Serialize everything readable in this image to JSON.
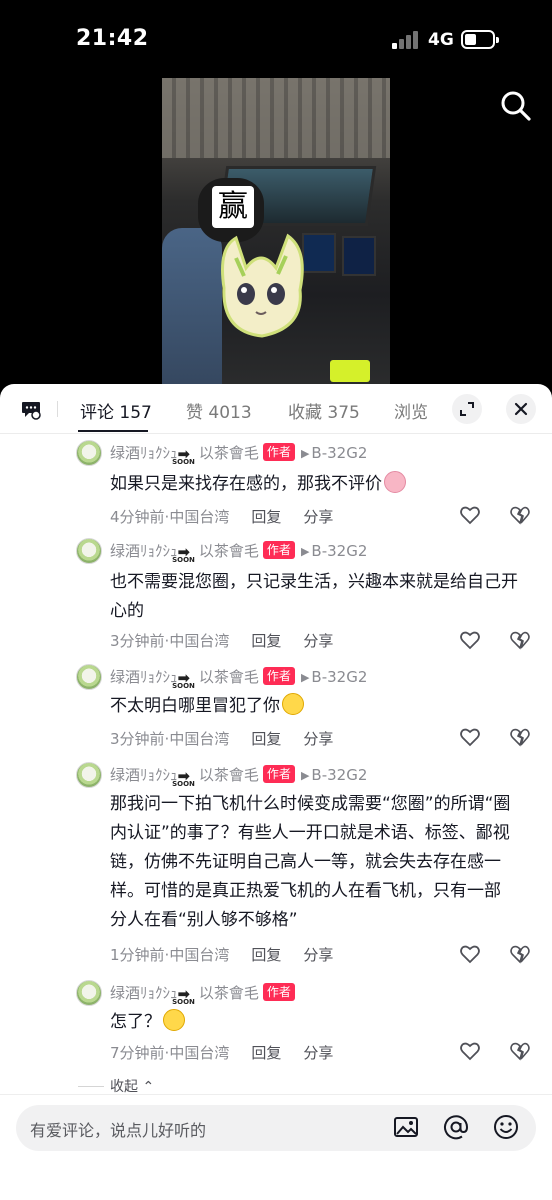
{
  "status_bar": {
    "time": "21:42",
    "network": "4G"
  },
  "video": {
    "sticker_text": "赢"
  },
  "tabs": [
    {
      "label": "评论 157",
      "active": true
    },
    {
      "label": "赞 4013",
      "active": false
    },
    {
      "label": "收藏 375",
      "active": false
    },
    {
      "label": "浏览",
      "active": false
    }
  ],
  "comments": [
    {
      "username": "绿酒ﾘｮｸｼｭ",
      "soon_tag": "SOON",
      "username_suffix": "以茶會毛",
      "badge": "作者",
      "reply_to": "B-32G2",
      "lines": [
        "如果只是来找存在感的，那我不评价"
      ],
      "emoji": "pig",
      "time": "4分钟前",
      "location": "中国台湾",
      "reply": "回复",
      "share": "分享"
    },
    {
      "username": "绿酒ﾘｮｸｼｭ",
      "soon_tag": "SOON",
      "username_suffix": "以茶會毛",
      "badge": "作者",
      "reply_to": "B-32G2",
      "lines": [
        "也不需要混您圈，只记录生活，兴趣本来就是给自己开",
        "心的"
      ],
      "emoji": "",
      "time": "3分钟前",
      "location": "中国台湾",
      "reply": "回复",
      "share": "分享"
    },
    {
      "username": "绿酒ﾘｮｸｼｭ",
      "soon_tag": "SOON",
      "username_suffix": "以茶會毛",
      "badge": "作者",
      "reply_to": "B-32G2",
      "lines": [
        "不太明白哪里冒犯了你"
      ],
      "emoji": "grin",
      "time": "3分钟前",
      "location": "中国台湾",
      "reply": "回复",
      "share": "分享"
    },
    {
      "username": "绿酒ﾘｮｸｼｭ",
      "soon_tag": "SOON",
      "username_suffix": "以茶會毛",
      "badge": "作者",
      "reply_to": "B-32G2",
      "lines": [
        "那我问一下拍飞机什么时候变成需要“您圈”的所谓“圈",
        "内认证”的事了？有些人一开口就是术语、标签、鄙视",
        "链，仿佛不先证明自己高人一等，就会失去存在感一",
        "样。可惜的是真正热爱飞机的人在看飞机，只有一部",
        "分人在看“别人够不够格”"
      ],
      "emoji": "",
      "time": "1分钟前",
      "location": "中国台湾",
      "reply": "回复",
      "share": "分享"
    },
    {
      "username": "绿酒ﾘｮｸｼｭ",
      "soon_tag": "SOON",
      "username_suffix": "以茶會毛",
      "badge": "作者",
      "reply_to": "",
      "lines": [
        "怎了？"
      ],
      "emoji": "grin",
      "time": "7分钟前",
      "location": "中国台湾",
      "reply": "回复",
      "share": "分享"
    }
  ],
  "collapse_label": "收起",
  "input": {
    "placeholder": "有爱评论，说点儿好听的"
  },
  "colors": {
    "accent": "#fe2c55",
    "text": "#161823",
    "muted": "#8a8b91"
  }
}
